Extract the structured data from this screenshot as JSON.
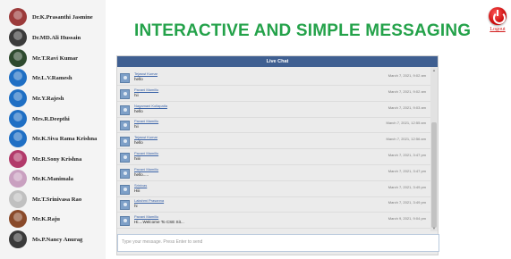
{
  "header": {
    "title": "INTERACTIVE AND SIMPLE MESSAGING",
    "logout_label": "Logout"
  },
  "sidebar": {
    "users": [
      {
        "name": "Dr.K.Prasanthi Jasmine",
        "avatar_color": "#9c3b3b"
      },
      {
        "name": "Dr.MD.Ali Hussain",
        "avatar_color": "#3b3b3b"
      },
      {
        "name": "Mr.T.Ravi Kumar",
        "avatar_color": "#2e4a2e"
      },
      {
        "name": "Mr.L.V.Ramesh",
        "avatar_color": "#1f6fc4"
      },
      {
        "name": "Mr.Y.Rajesh",
        "avatar_color": "#1f6fc4"
      },
      {
        "name": "Mrs.R.Deepthi",
        "avatar_color": "#1f6fc4"
      },
      {
        "name": "Mr.K.Siva Rama Krishna",
        "avatar_color": "#1f6fc4"
      },
      {
        "name": "Mr.R.Sony Krishna",
        "avatar_color": "#b23a6a"
      },
      {
        "name": "Mr.K.Manimala",
        "avatar_color": "#c9a0c0"
      },
      {
        "name": "Mr.T.Srinivasa Rao",
        "avatar_color": "#c0c0c0"
      },
      {
        "name": "Mr.K.Raju",
        "avatar_color": "#8a4a2a"
      },
      {
        "name": "Ms.P.Nancy Anurag",
        "avatar_color": "#3a3a3a"
      }
    ]
  },
  "chat": {
    "title": "Live Chat",
    "input_placeholder": "Type your message. Press Enter to send",
    "messages": [
      {
        "name": "Tejaswi Kumar",
        "text": "hello",
        "time": "March 7, 2021, 9:02 am"
      },
      {
        "name": "Pavani Mamillu",
        "text": "hii",
        "time": "March 7, 2021, 9:02 am"
      },
      {
        "name": "Nagamani Kollapatla",
        "text": "hello",
        "time": "March 7, 2021, 9:03 am"
      },
      {
        "name": "Pavani Mamillu",
        "text": "hii",
        "time": "March 7, 2021, 12:55 am"
      },
      {
        "name": "Tejaswi Kumar",
        "text": "hello",
        "time": "March 7, 2021, 12:56 am"
      },
      {
        "name": "Pavani Mamillu",
        "text": "hiiii",
        "time": "March 7, 2021, 3:47 pm"
      },
      {
        "name": "Pavani Mamillu",
        "text": "hello.....",
        "time": "March 7, 2021, 3:47 pm"
      },
      {
        "name": "Srinivas",
        "text": "Hiii",
        "time": "March 7, 2021, 3:49 pm"
      },
      {
        "name": "Lakshmi Prasanna",
        "text": "hi",
        "time": "March 7, 2021, 3:49 pm"
      },
      {
        "name": "Pavani Mamillu",
        "text": "Hi....Welcome To CSE Sit...",
        "time": "March 9, 2021, 9:04 pm"
      }
    ]
  }
}
